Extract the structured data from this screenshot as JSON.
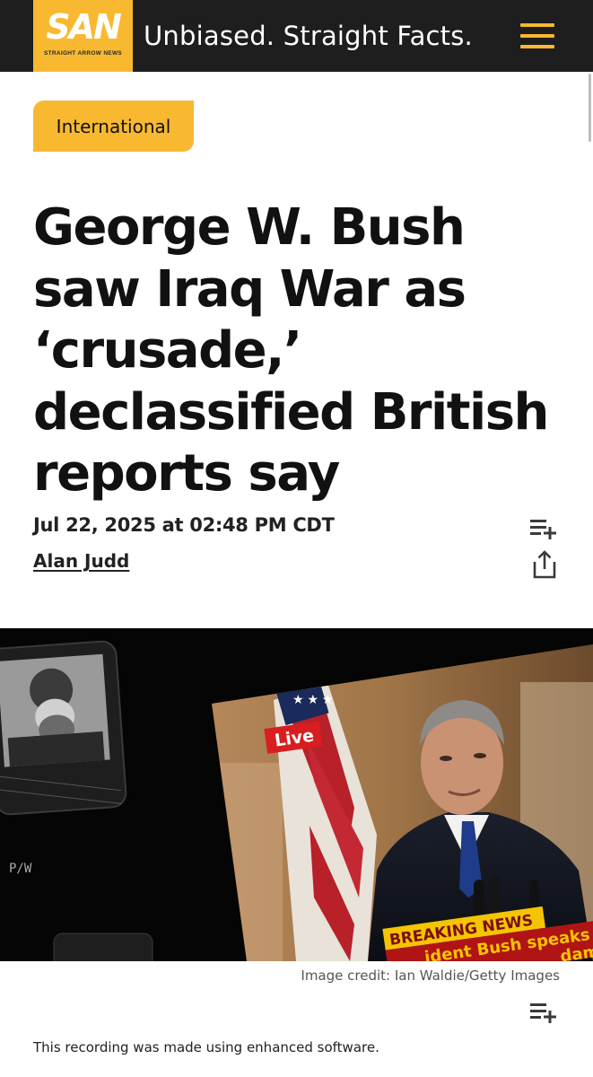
{
  "brand": {
    "logo_text": "SAN",
    "logo_subtext": "STRAIGHT ARROW NEWS",
    "tagline": "Unbiased. Straight Facts.",
    "accent_color": "#f8b930",
    "header_color": "#1e1e1e"
  },
  "article": {
    "category": "International",
    "headline": "George W. Bush saw Iraq War as ‘crusade,’ declassified British reports say",
    "date": "Jul 22, 2025 at 02:48 PM CDT",
    "author": "Alan Judd",
    "image": {
      "live_tag": "Live",
      "breaking_label": "BREAKING NEWS",
      "ticker_text": "ident Bush speaks",
      "ticker_text_2": "dam Hu",
      "watermark": "P/W",
      "credit": "Image credit: Ian Waldie/Getty Images"
    },
    "recording_note": "This recording was made using enhanced software."
  },
  "icons": {
    "menu": "hamburger-menu-icon",
    "playlist": "add-to-playlist-icon",
    "share": "share-icon"
  }
}
